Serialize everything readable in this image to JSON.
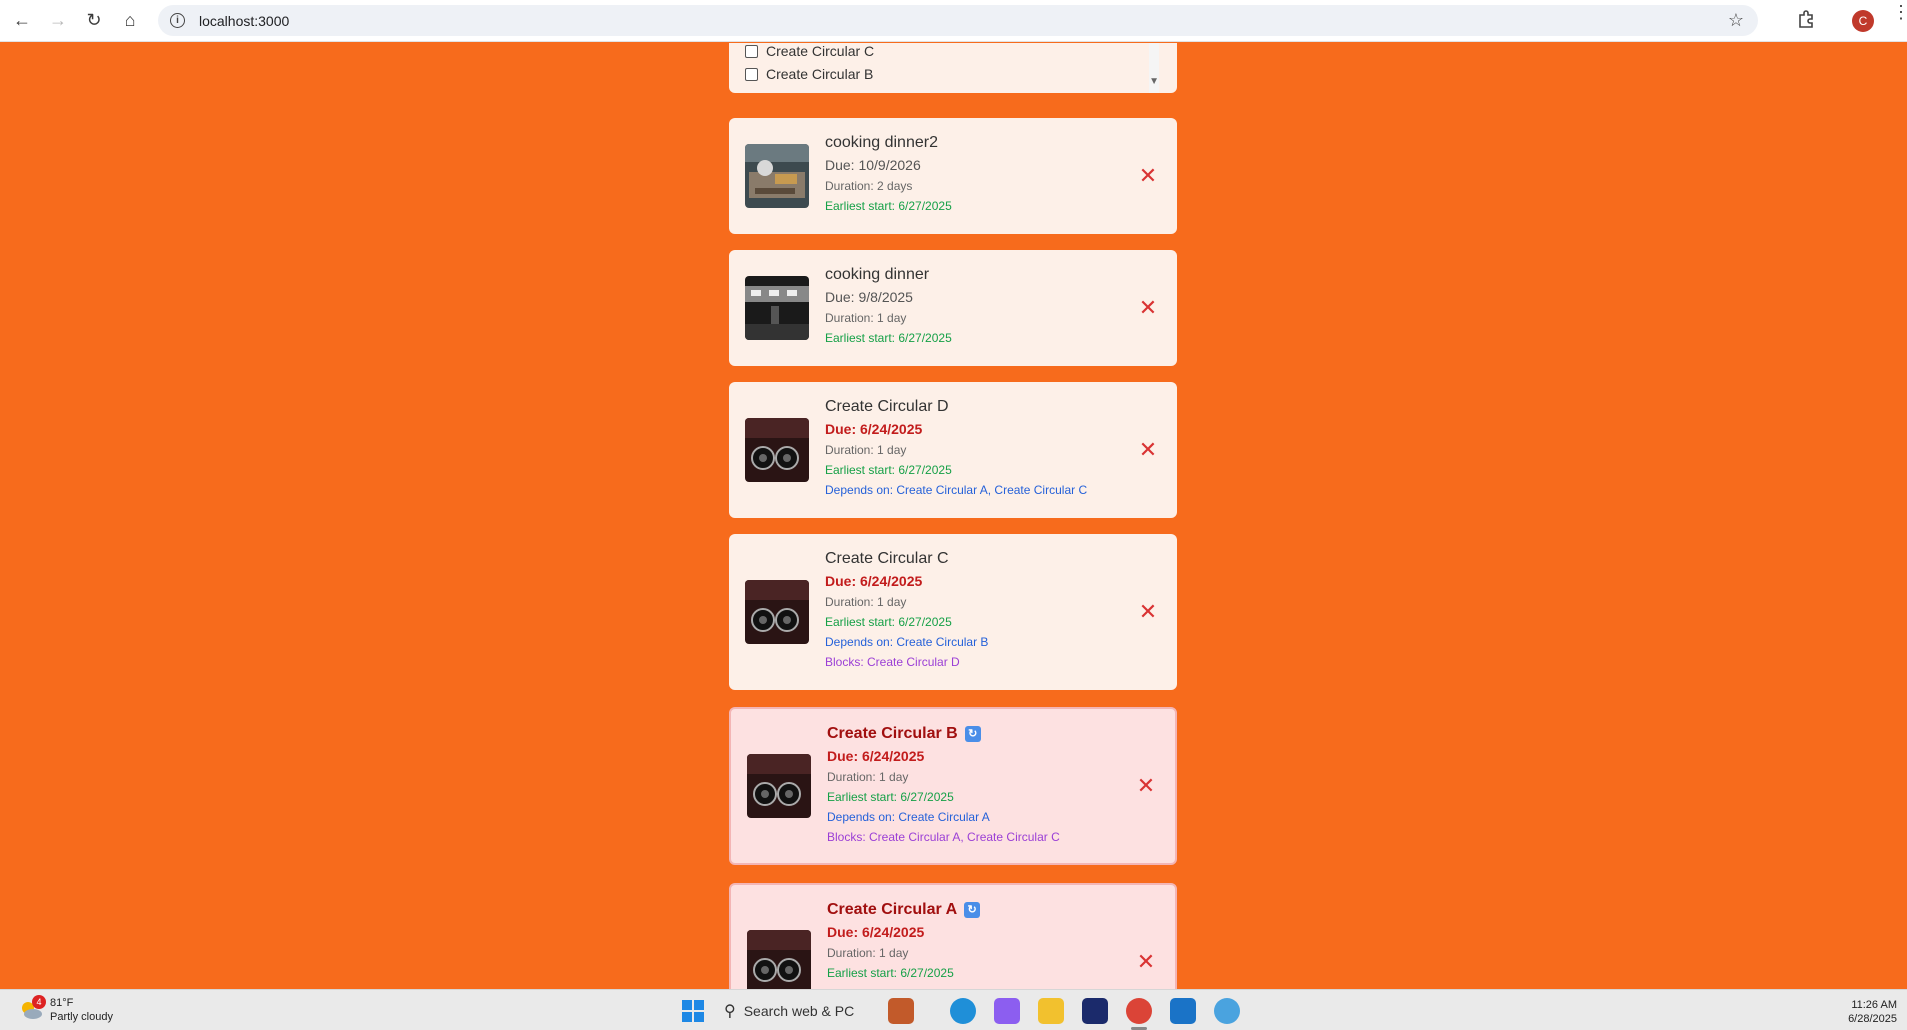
{
  "browser": {
    "url": "localhost:3000",
    "profile_initial": "C"
  },
  "filter": {
    "items": [
      {
        "label": "Create Circular C"
      },
      {
        "label": "Create Circular B"
      }
    ]
  },
  "tasks": [
    {
      "title": "cooking dinner2",
      "due": "Due: 10/9/2026",
      "duration": "Duration: 2 days",
      "earliest": "Earliest start: 6/27/2025",
      "thumb": "kitchen"
    },
    {
      "title": "cooking dinner",
      "due": "Due: 9/8/2025",
      "duration": "Duration: 1 day",
      "earliest": "Earliest start: 6/27/2025",
      "thumb": "kitchen-dark"
    },
    {
      "title": "Create Circular D",
      "due": "Due: 6/24/2025",
      "duration": "Duration: 1 day",
      "earliest": "Earliest start: 6/27/2025",
      "depends": "Depends on: Create Circular A, Create Circular C",
      "thumb": "speakers"
    },
    {
      "title": "Create Circular C",
      "due": "Due: 6/24/2025",
      "duration": "Duration: 1 day",
      "earliest": "Earliest start: 6/27/2025",
      "depends": "Depends on: Create Circular B",
      "blocks": "Blocks: Create Circular D",
      "thumb": "speakers"
    },
    {
      "title": "Create Circular B",
      "due": "Due: 6/24/2025",
      "duration": "Duration: 1 day",
      "earliest": "Earliest start: 6/27/2025",
      "depends": "Depends on: Create Circular A",
      "blocks": "Blocks: Create Circular A, Create Circular C",
      "badge": "🔄",
      "thumb": "speakers"
    },
    {
      "title": "Create Circular A",
      "due": "Due: 6/24/2025",
      "duration": "Duration: 1 day",
      "earliest": "Earliest start: 6/27/2025",
      "badge": "🔄",
      "thumb": "speakers"
    }
  ],
  "colors": {
    "page_background": "#f76b1c",
    "card_background": "#fdf0e8",
    "circular_card_background": "#fde1e1",
    "overdue": "#c21c1c",
    "earliest_start": "#15a047",
    "depends": "#2561d9",
    "blocks": "#9b3fd6",
    "delete": "#d93333"
  },
  "taskbar": {
    "weather_temp": "81°F",
    "weather_desc": "Partly cloudy",
    "weather_badge": "4",
    "search_placeholder": "Search web & PC",
    "time": "11:26 AM",
    "date": "6/28/2025"
  }
}
